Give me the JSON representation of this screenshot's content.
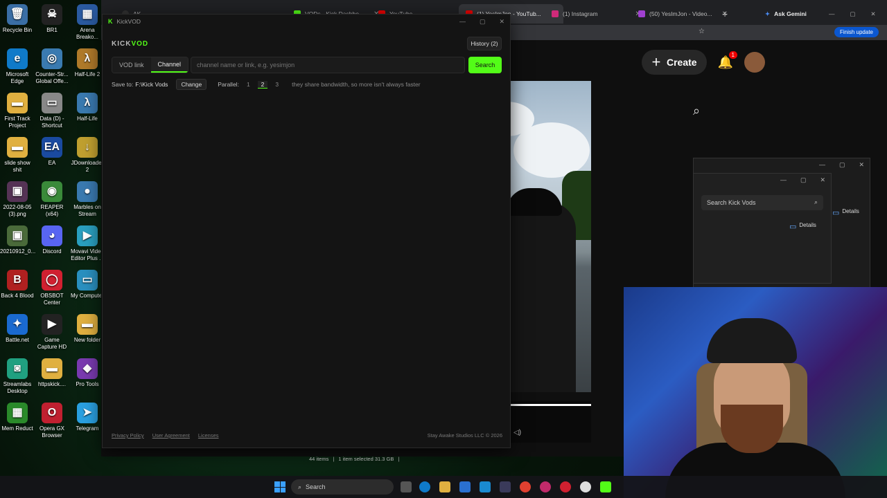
{
  "desktop": {
    "icons": [
      {
        "label": "Recycle Bin",
        "glyph": "🗑",
        "color": "#3a6ea5"
      },
      {
        "label": "BR1",
        "glyph": "☠",
        "color": "#222"
      },
      {
        "label": "Arena Breako...",
        "glyph": "▦",
        "color": "#2a5aa0"
      },
      {
        "label": "Microsoft Edge",
        "glyph": "e",
        "color": "#0f7ac9"
      },
      {
        "label": "Counter-Str... Global Offe...",
        "glyph": "◎",
        "color": "#3a7ab0"
      },
      {
        "label": "Half-Life 2",
        "glyph": "λ",
        "color": "#b07a2a"
      },
      {
        "label": "First Track Project",
        "glyph": "▬",
        "color": "#e0b040"
      },
      {
        "label": "Data (D) - Shortcut",
        "glyph": "▭",
        "color": "#888"
      },
      {
        "label": "Half-Life",
        "glyph": "λ",
        "color": "#3a7ab0"
      },
      {
        "label": "slide show shit",
        "glyph": "▬",
        "color": "#e0b040"
      },
      {
        "label": "EA",
        "glyph": "EA",
        "color": "#1a4aa0"
      },
      {
        "label": "JDownloader 2",
        "glyph": "↓",
        "color": "#c0a030"
      },
      {
        "label": "2022-08-05 (3).png",
        "glyph": "▣",
        "color": "#553355"
      },
      {
        "label": "REAPER (x64)",
        "glyph": "◉",
        "color": "#3a8a3a"
      },
      {
        "label": "Marbles on Stream",
        "glyph": "●",
        "color": "#3a7ab0"
      },
      {
        "label": "20210912_0...",
        "glyph": "▣",
        "color": "#4a6a3a"
      },
      {
        "label": "Discord",
        "glyph": "◕",
        "color": "#5865f2"
      },
      {
        "label": "Movavi Video Editor Plus ...",
        "glyph": "▶",
        "color": "#2aa0c0"
      },
      {
        "label": "Back 4 Blood",
        "glyph": "B",
        "color": "#b02020"
      },
      {
        "label": "OBSBOT Center",
        "glyph": "◯",
        "color": "#d02030"
      },
      {
        "label": "My Computer",
        "glyph": "▭",
        "color": "#2a90c0"
      },
      {
        "label": "Battle.net",
        "glyph": "✦",
        "color": "#1a6ad0"
      },
      {
        "label": "Game Capture HD",
        "glyph": "▶",
        "color": "#222"
      },
      {
        "label": "New folder",
        "glyph": "▬",
        "color": "#e0b040"
      },
      {
        "label": "Streamlabs Desktop",
        "glyph": "◙",
        "color": "#20a080"
      },
      {
        "label": "httpskick....",
        "glyph": "▬",
        "color": "#e0b040"
      },
      {
        "label": "Pro Tools",
        "glyph": "◆",
        "color": "#7a3ab0"
      },
      {
        "label": "Mem Reduct",
        "glyph": "▦",
        "color": "#2a8a2a"
      },
      {
        "label": "Opera GX Browser",
        "glyph": "O",
        "color": "#c02030"
      },
      {
        "label": "Telegram",
        "glyph": "➤",
        "color": "#2aa0e0"
      }
    ]
  },
  "browser": {
    "tabs": [
      {
        "label": "AK",
        "color": "#333"
      },
      {
        "label": "VODs - Kick Dashbo...",
        "color": "#53fc18"
      },
      {
        "label": "YouTube",
        "color": "#e00"
      },
      {
        "label": "(1) YesImJon - YouTub...",
        "color": "#e00"
      },
      {
        "label": "(1) Instagram",
        "color": "#d02a7a"
      },
      {
        "label": "(50) YesImJon - Video...",
        "color": "#a040d0"
      },
      {
        "label": "Ask Gemini",
        "color": "#4a8af0"
      }
    ],
    "new_tab": "+",
    "finish_update": "Finish update",
    "create_label": "Create",
    "notif_count": "1"
  },
  "explorer": {
    "search_placeholder": "Search Kick Vods",
    "details_label": "Details",
    "details_label_2": "Details",
    "status": {
      "items": "44 items",
      "selected": "1 item selected  31.3 GB"
    }
  },
  "kickvod": {
    "window_title": "KickVOD",
    "brand_kick": "KICK",
    "brand_vod": "VOD",
    "history_label": "History (2)",
    "modes": [
      "VOD link",
      "Channel"
    ],
    "active_mode": "Channel",
    "channel_placeholder": "channel name or link, e.g. yesimjon",
    "search_label": "Search",
    "save_to_label": "Save to:",
    "save_path": "F:\\Kick Vods",
    "change_label": "Change",
    "parallel_label": "Parallel:",
    "parallel_options": [
      "1",
      "2",
      "3"
    ],
    "parallel_selected": "2",
    "parallel_hint": "they share bandwidth, so more isn't always faster",
    "footer": {
      "privacy": "Privacy Policy",
      "agreement": "User Agreement",
      "licenses": "Licenses",
      "copyright": "Stay Awake Studios LLC © 2026"
    },
    "accent": "#53fc18"
  },
  "taskbar": {
    "search_label": "Search"
  }
}
